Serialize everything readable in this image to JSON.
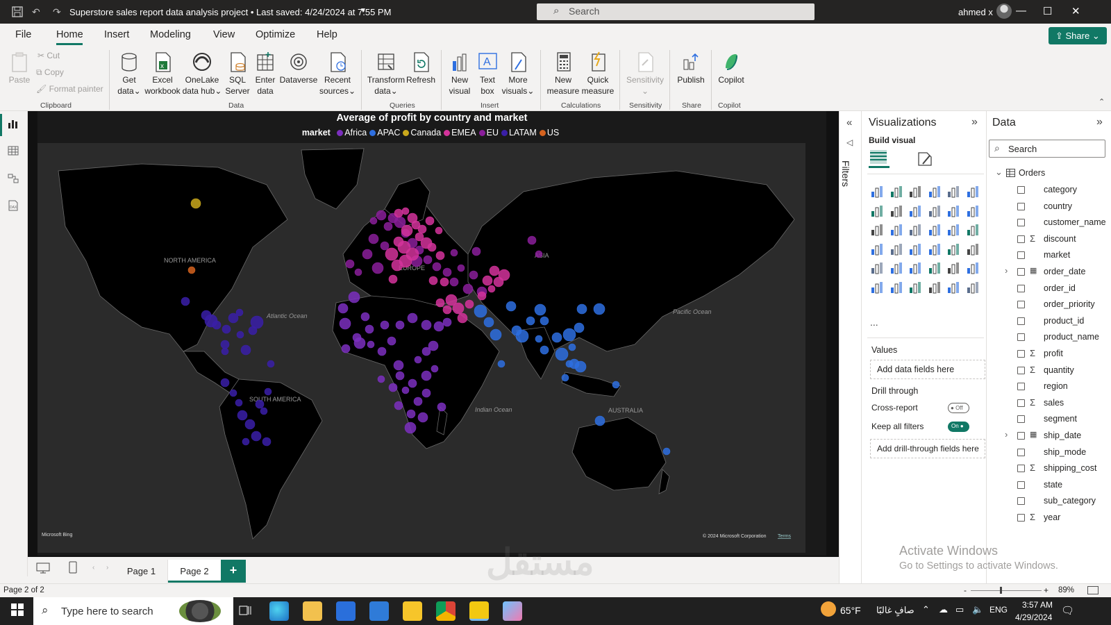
{
  "titlebar": {
    "doc_title": "Superstore sales report data analysis project  •  Last saved: 4/24/2024 at 7:55 PM",
    "search_placeholder": "Search",
    "user": "ahmed x"
  },
  "menu": {
    "items": [
      "File",
      "Home",
      "Insert",
      "Modeling",
      "View",
      "Optimize",
      "Help"
    ],
    "active": "Home",
    "share": "Share"
  },
  "ribbon": {
    "clipboard": {
      "paste": "Paste",
      "cut": "Cut",
      "copy": "Copy",
      "format_painter": "Format painter",
      "label": "Clipboard"
    },
    "data": {
      "get_data": [
        "Get",
        "data"
      ],
      "excel": [
        "Excel",
        "workbook"
      ],
      "onelake": [
        "OneLake",
        "data hub"
      ],
      "sql": [
        "SQL",
        "Server"
      ],
      "enter": [
        "Enter",
        "data"
      ],
      "dataverse": "Dataverse",
      "recent": [
        "Recent",
        "sources"
      ],
      "label": "Data"
    },
    "queries": {
      "transform": [
        "Transform",
        "data"
      ],
      "refresh": "Refresh",
      "label": "Queries"
    },
    "insert": {
      "new_visual": [
        "New",
        "visual"
      ],
      "text_box": [
        "Text",
        "box"
      ],
      "more_visuals": [
        "More",
        "visuals"
      ],
      "label": "Insert"
    },
    "calculations": {
      "new_measure": [
        "New",
        "measure"
      ],
      "quick_measure": [
        "Quick",
        "measure"
      ],
      "label": "Calculations"
    },
    "sensitivity": {
      "sensitivity": "Sensitivity",
      "label": "Sensitivity"
    },
    "share": {
      "publish": "Publish",
      "label": "Share"
    },
    "copilot": {
      "copilot": "Copilot",
      "label": "Copilot"
    }
  },
  "chart_data": {
    "type": "scatter",
    "subtype": "map-bubble",
    "title": "Average of profit by country and market",
    "legend_title": "market",
    "legend_placement": "top-center",
    "series": [
      {
        "name": "Africa",
        "color": "#7b2fbe"
      },
      {
        "name": "APAC",
        "color": "#2e6fe0"
      },
      {
        "name": "Canada",
        "color": "#c9a81c"
      },
      {
        "name": "EMEA",
        "color": "#d4339b"
      },
      {
        "name": "EU",
        "color": "#8a1e9a"
      },
      {
        "name": "LATAM",
        "color": "#3a1fa8"
      },
      {
        "name": "US",
        "color": "#d5631f"
      }
    ],
    "map_labels": [
      "NORTH AMERICA",
      "SOUTH AMERICA",
      "EUROPE",
      "ASIA",
      "AUSTRALIA",
      "Atlantic Ocean",
      "Pacific Ocean",
      "Indian Ocean"
    ],
    "attribution_left": "Microsoft Bing",
    "attribution_right": "© 2024 Microsoft Corporation",
    "terms": "Terms"
  },
  "pages": {
    "tabs": [
      "Page 1",
      "Page 2"
    ],
    "active": "Page 2",
    "add": "+"
  },
  "status": {
    "page_info": "Page 2 of 2",
    "zoom": "89%"
  },
  "filters": {
    "label": "Filters"
  },
  "visualizations": {
    "title": "Visualizations",
    "build_visual": "Build visual",
    "values_label": "Values",
    "values_placeholder": "Add data fields here",
    "drill_through": "Drill through",
    "cross_report": "Cross-report",
    "cross_report_state": "Off",
    "keep_filters": "Keep all filters",
    "keep_filters_state": "On",
    "drill_placeholder": "Add drill-through fields here",
    "more": "..."
  },
  "data_pane": {
    "title": "Data",
    "search_placeholder": "Search",
    "table": "Orders",
    "fields": [
      {
        "name": "category",
        "sigma": false,
        "kind": "text"
      },
      {
        "name": "country",
        "sigma": false,
        "kind": "text"
      },
      {
        "name": "customer_name",
        "sigma": false,
        "kind": "text"
      },
      {
        "name": "discount",
        "sigma": true,
        "kind": "num"
      },
      {
        "name": "market",
        "sigma": false,
        "kind": "text"
      },
      {
        "name": "order_date",
        "sigma": false,
        "kind": "date"
      },
      {
        "name": "order_id",
        "sigma": false,
        "kind": "text"
      },
      {
        "name": "order_priority",
        "sigma": false,
        "kind": "text"
      },
      {
        "name": "product_id",
        "sigma": false,
        "kind": "text"
      },
      {
        "name": "product_name",
        "sigma": false,
        "kind": "text"
      },
      {
        "name": "profit",
        "sigma": true,
        "kind": "num"
      },
      {
        "name": "quantity",
        "sigma": true,
        "kind": "num"
      },
      {
        "name": "region",
        "sigma": false,
        "kind": "text"
      },
      {
        "name": "sales",
        "sigma": true,
        "kind": "num"
      },
      {
        "name": "segment",
        "sigma": false,
        "kind": "text"
      },
      {
        "name": "ship_date",
        "sigma": false,
        "kind": "date"
      },
      {
        "name": "ship_mode",
        "sigma": false,
        "kind": "text"
      },
      {
        "name": "shipping_cost",
        "sigma": true,
        "kind": "num"
      },
      {
        "name": "state",
        "sigma": false,
        "kind": "text"
      },
      {
        "name": "sub_category",
        "sigma": false,
        "kind": "text"
      },
      {
        "name": "year",
        "sigma": true,
        "kind": "num"
      }
    ]
  },
  "activation": {
    "line1": "Activate Windows",
    "line2": "Go to Settings to activate Windows."
  },
  "watermark": "مستقل",
  "taskbar": {
    "search_placeholder": "Type here to search",
    "weather": "65°F",
    "weather_text": "صافٍ غالبًا",
    "lang": "ENG",
    "time": "3:57 AM",
    "date": "4/29/2024"
  }
}
